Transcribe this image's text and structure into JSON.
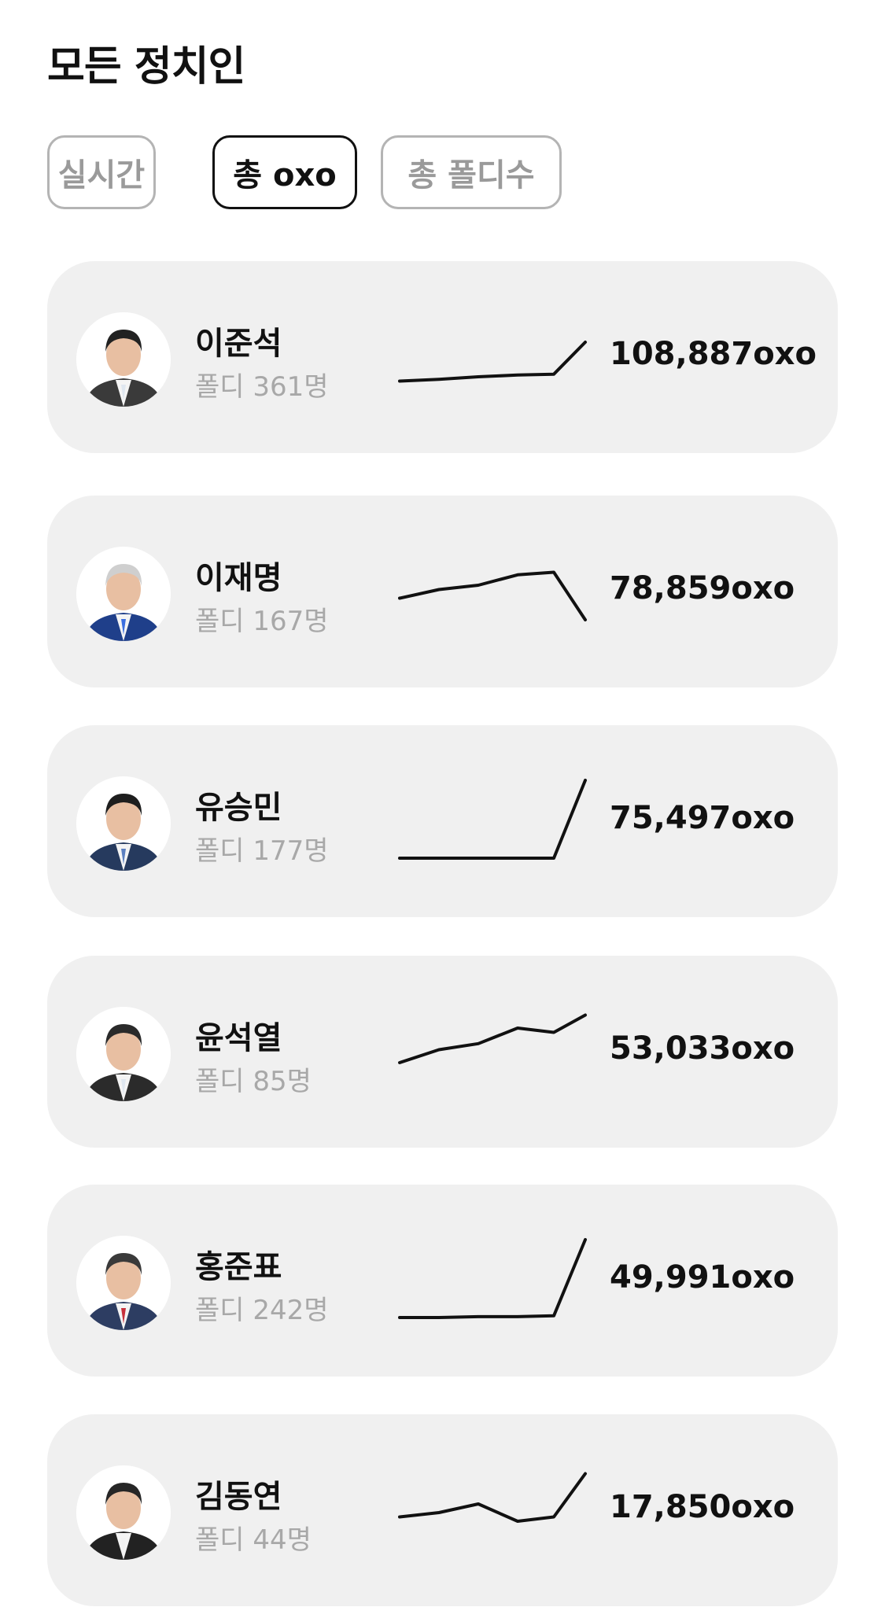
{
  "page": {
    "title": "모든 정치인"
  },
  "tabs": [
    {
      "label": "실시간",
      "active": false
    },
    {
      "label": "총 oxo",
      "active": true
    },
    {
      "label": "총 폴디수",
      "active": false
    }
  ],
  "politicians": [
    {
      "name": "이준석",
      "fans": "폴디 361명",
      "value": "108,887oxo",
      "trend": [
        0.25,
        0.27,
        0.3,
        0.32,
        0.33,
        0.7
      ]
    },
    {
      "name": "이재명",
      "fans": "폴디 167명",
      "value": "78,859oxo",
      "trend": [
        0.45,
        0.55,
        0.6,
        0.72,
        0.75,
        0.2
      ]
    },
    {
      "name": "유승민",
      "fans": "폴디 177명",
      "value": "75,497oxo",
      "trend": [
        0.1,
        0.1,
        0.1,
        0.1,
        0.1,
        1.0
      ]
    },
    {
      "name": "윤석열",
      "fans": "폴디 85명",
      "value": "53,033oxo",
      "trend": [
        0.4,
        0.55,
        0.62,
        0.8,
        0.75,
        0.95
      ]
    },
    {
      "name": "홍준표",
      "fans": "폴디 242명",
      "value": "49,991oxo",
      "trend": [
        0.1,
        0.1,
        0.11,
        0.11,
        0.12,
        1.0
      ]
    },
    {
      "name": "김동연",
      "fans": "폴디 44명",
      "value": "17,850oxo",
      "trend": [
        0.45,
        0.5,
        0.6,
        0.4,
        0.45,
        0.95
      ]
    }
  ],
  "colors": {
    "card_bg": "#f0f0f0",
    "muted_text": "#a8a8a8",
    "line": "#111111"
  }
}
